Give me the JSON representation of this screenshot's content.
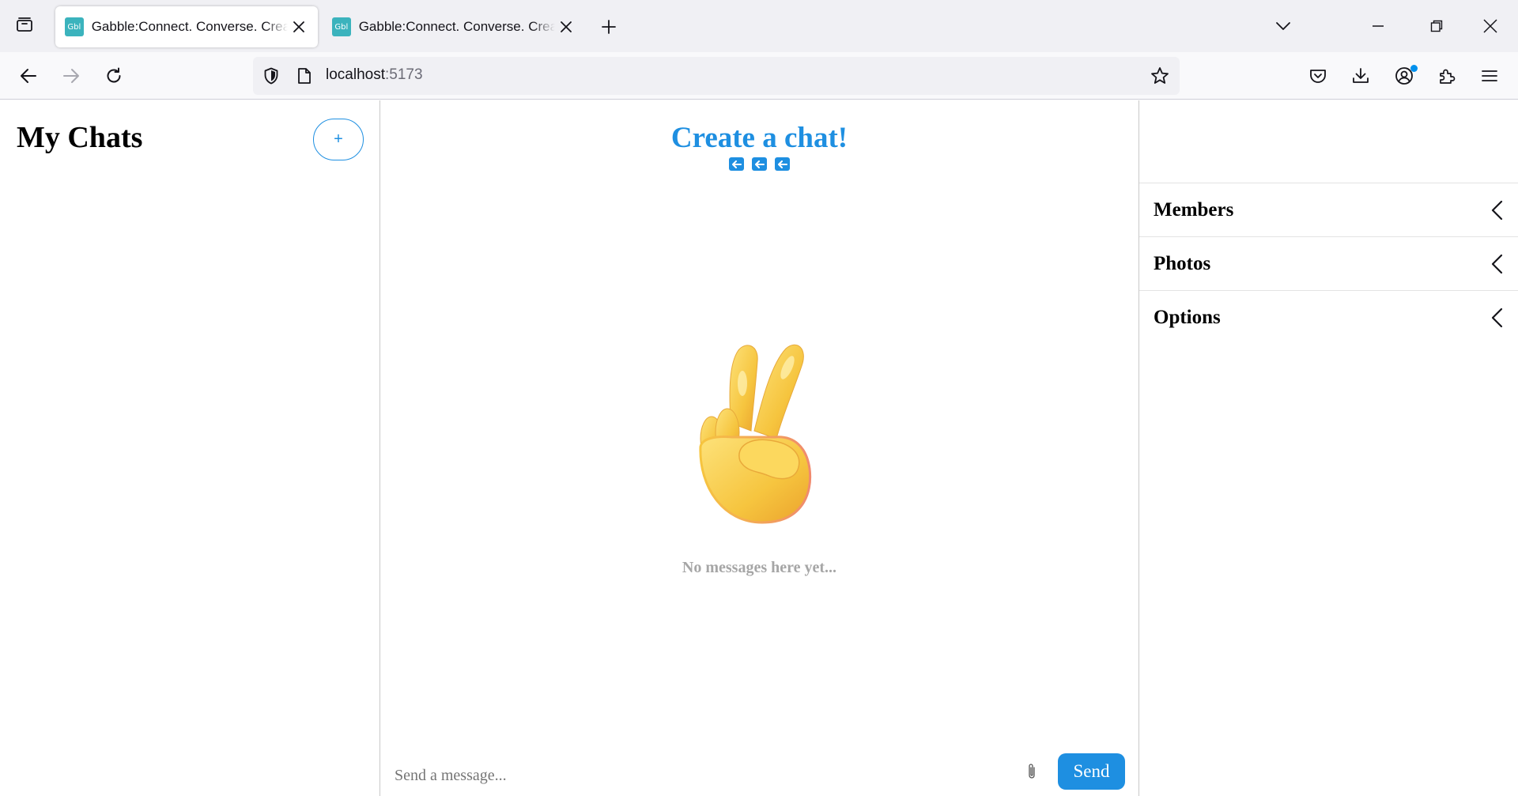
{
  "browser": {
    "tabs": [
      {
        "title": "Gabble:Connect. Converse. Create.",
        "active": true,
        "favicon_text": "Gbl"
      },
      {
        "title": "Gabble:Connect. Converse. Create.",
        "active": false,
        "favicon_text": "Gbl"
      }
    ],
    "url": {
      "host": "localhost",
      "port": ":5173"
    },
    "icons": {
      "tab_overview": "tab-list-icon",
      "new_tab": "plus-icon",
      "list_all_tabs": "chevron-down-icon",
      "minimize": "minimize-icon",
      "restore": "restore-icon",
      "close_window": "close-icon",
      "back": "back-arrow-icon",
      "forward": "forward-arrow-icon",
      "reload": "reload-icon",
      "shield": "shield-icon",
      "page_info": "page-icon",
      "bookmark": "star-icon",
      "pocket": "pocket-icon",
      "downloads": "download-icon",
      "account": "account-icon",
      "extensions": "extensions-icon",
      "menu": "hamburger-menu-icon"
    },
    "accent_color": "#0090ed"
  },
  "sidebar": {
    "title": "My Chats",
    "new_chat_label": "+"
  },
  "chat": {
    "title": "Create a chat!",
    "empty_message": "No messages here yet...",
    "input_placeholder": "Send a message...",
    "send_label": "Send",
    "accent_color": "#1e8fe1",
    "illustration": "victory-hand-emoji"
  },
  "details": {
    "sections": [
      {
        "label": "Members"
      },
      {
        "label": "Photos"
      },
      {
        "label": "Options"
      }
    ]
  }
}
